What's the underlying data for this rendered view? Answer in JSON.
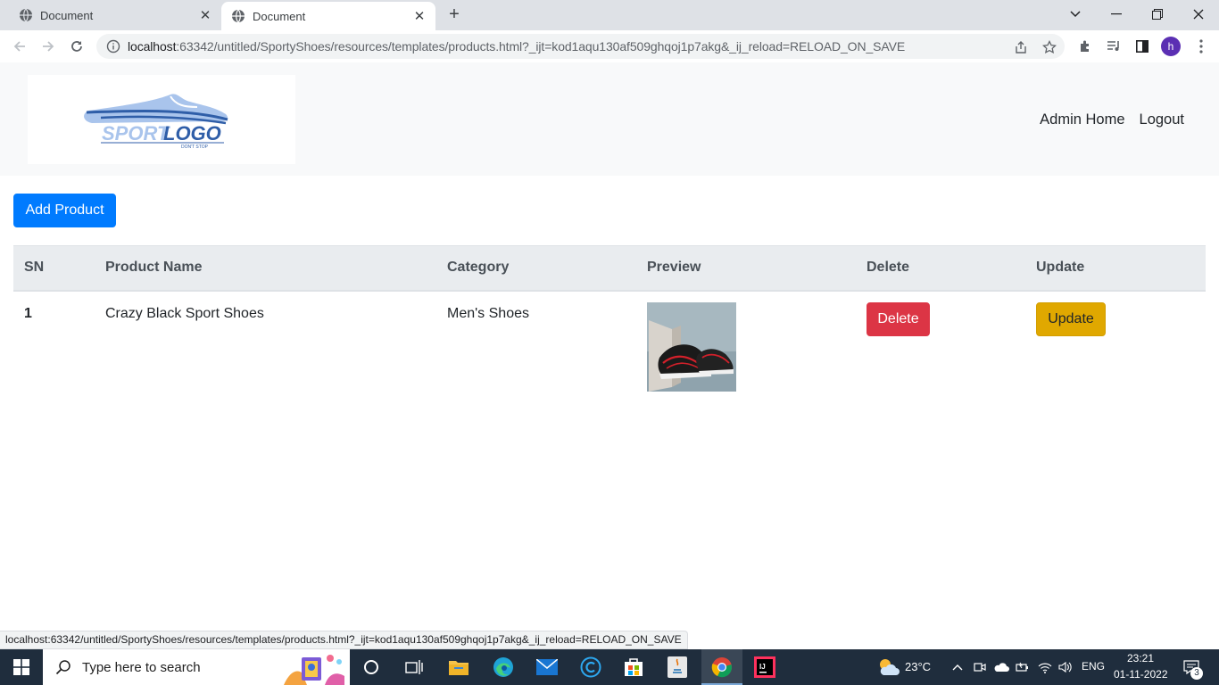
{
  "browser": {
    "tabs": [
      {
        "title": "Document"
      },
      {
        "title": "Document"
      }
    ],
    "url_host": "localhost",
    "url_rest": ":63342/untitled/SportyShoes/resources/templates/products.html?_ijt=kod1aqu130af509ghqoj1p7akg&_ij_reload=RELOAD_ON_SAVE",
    "profile_initial": "h",
    "status_url": "localhost:63342/untitled/SportyShoes/resources/templates/products.html?_ijt=kod1aqu130af509ghqoj1p7akg&_ij_reload=RELOAD_ON_SAVE"
  },
  "navbar": {
    "logo_text": "SPORTLOGO",
    "logo_tagline": "DON'T STOP",
    "links": {
      "admin_home": "Admin Home",
      "logout": "Logout"
    }
  },
  "actions": {
    "add_product": "Add Product"
  },
  "table": {
    "headers": {
      "sn": "SN",
      "product_name": "Product Name",
      "category": "Category",
      "preview": "Preview",
      "delete": "Delete",
      "update": "Update"
    },
    "rows": [
      {
        "sn": "1",
        "product_name": "Crazy Black Sport Shoes",
        "category": "Men's Shoes",
        "delete_label": "Delete",
        "update_label": "Update"
      }
    ]
  },
  "taskbar": {
    "search_placeholder": "Type here to search",
    "weather": "23°C",
    "language": "ENG",
    "time": "23:21",
    "date": "01-11-2022",
    "notification_count": "3"
  },
  "colors": {
    "primary": "#007bff",
    "danger": "#dc3545",
    "warning": "#e0a800",
    "navbar_bg": "#f8f9fa",
    "header_bg": "#e9ecef"
  }
}
